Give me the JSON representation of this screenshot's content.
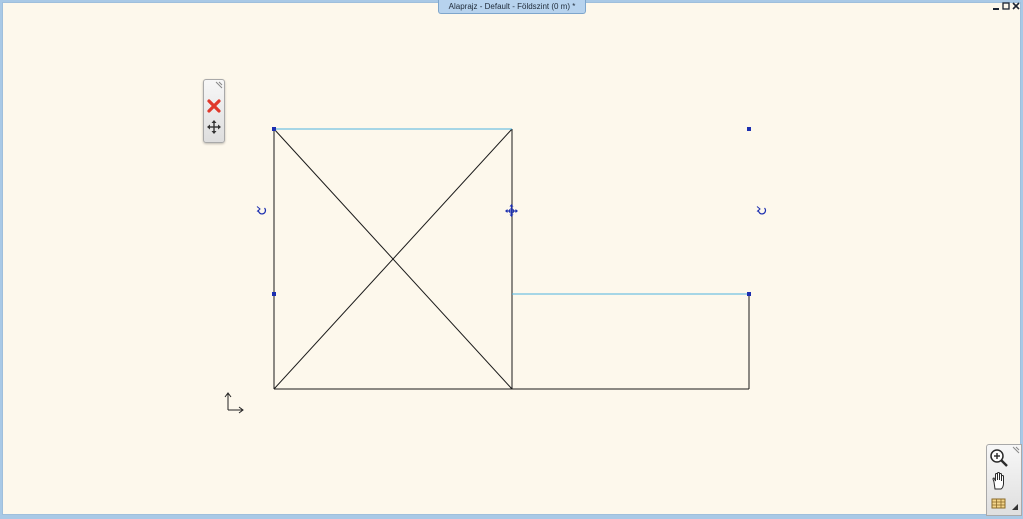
{
  "window": {
    "title": "Alaprajz - Default - Földszint (0 m) *",
    "controls": {
      "minimize_icon": "minimize-icon",
      "maximize_icon": "maximize-icon",
      "close_icon": "close-icon"
    }
  },
  "toolbar": {
    "items": [
      {
        "icon": "delete-icon",
        "color": "#e0392b"
      },
      {
        "icon": "move-icon",
        "color": "#333333"
      }
    ]
  },
  "navigation": {
    "items": [
      {
        "icon": "zoom-in-icon"
      },
      {
        "icon": "pan-hand-icon"
      },
      {
        "icon": "layers-icon"
      }
    ]
  },
  "drawing": {
    "colors": {
      "line": "#1a1a1a",
      "selection": "#4fb3e0",
      "handle": "#1c2fb0",
      "background": "#fdf8ec"
    }
  }
}
